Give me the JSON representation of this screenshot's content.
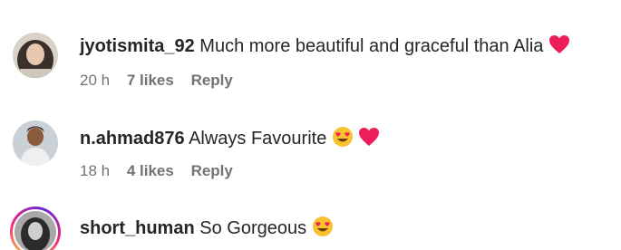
{
  "comments": [
    {
      "username": "jyotismita_92",
      "text": "Much more beautiful and graceful than Alia",
      "emojis": [
        "red-heart"
      ],
      "time": "20 h",
      "likes": "7 likes",
      "reply": "Reply"
    },
    {
      "username": "n.ahmad876",
      "text": "Always Favourite",
      "emojis": [
        "heart-eyes",
        "red-heart"
      ],
      "time": "18 h",
      "likes": "4 likes",
      "reply": "Reply"
    },
    {
      "username": "short_human",
      "text": "So Gorgeous",
      "emojis": [
        "heart-eyes"
      ],
      "has_story": true
    }
  ],
  "colors": {
    "text": "#262626",
    "meta": "#737373",
    "heart": "#ed1f5a",
    "emoji_face": "#f9c12e"
  }
}
